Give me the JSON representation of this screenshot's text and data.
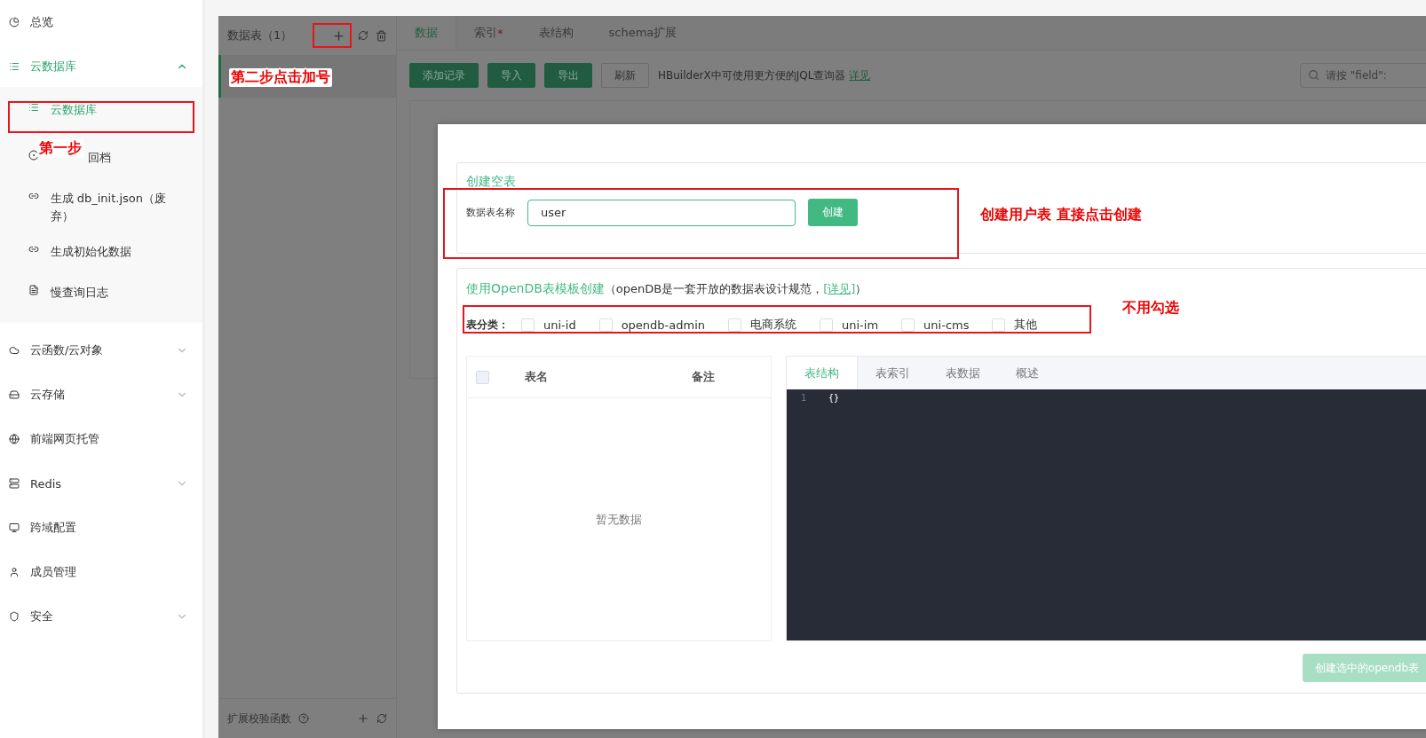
{
  "sidebar": {
    "items": [
      {
        "label": "总览",
        "selected": false
      },
      {
        "label": "云数据库",
        "selected": true,
        "expanded": true,
        "children": [
          {
            "label": "云数据库",
            "selected": true
          },
          {
            "label": "回档",
            "selected": false
          },
          {
            "label": "生成 db_init.json（废弃）",
            "selected": false
          },
          {
            "label": "生成初始化数据",
            "selected": false
          },
          {
            "label": "慢查询日志",
            "selected": false
          }
        ]
      },
      {
        "label": "云函数/云对象",
        "selected": false,
        "expanded": false
      },
      {
        "label": "云存储",
        "selected": false,
        "expanded": false
      },
      {
        "label": "前端网页托管",
        "selected": false
      },
      {
        "label": "Redis",
        "selected": false,
        "expanded": false
      },
      {
        "label": "跨域配置",
        "selected": false
      },
      {
        "label": "成员管理",
        "selected": false
      },
      {
        "label": "安全",
        "selected": false,
        "expanded": false
      }
    ]
  },
  "tables_panel": {
    "title": "数据表（1）",
    "tables": [
      {
        "selected": true
      }
    ],
    "footer": "扩展校验函数"
  },
  "tabs": [
    {
      "label": "数据",
      "selected": true
    },
    {
      "label": "索引",
      "badge": "*",
      "selected": false
    },
    {
      "label": "表结构",
      "selected": false
    },
    {
      "label": "schema扩展",
      "selected": false
    }
  ],
  "toolbar": {
    "buttons": [
      {
        "label": "添加记录",
        "kind": "primary"
      },
      {
        "label": "导入",
        "kind": "primary"
      },
      {
        "label": "导出",
        "kind": "primary"
      },
      {
        "label": "刷新",
        "kind": "default"
      }
    ],
    "hint": "HBuilderX中可使用更方便的JQL查询器",
    "hint_link": "详见",
    "search": {
      "placeholder": "请按 \"field\":"
    }
  },
  "modal": {
    "create_empty": {
      "title": "创建空表",
      "field_label": "数据表名称",
      "value": "user",
      "button": "创建"
    },
    "opendb": {
      "title": "使用OpenDB表模板创建",
      "note_before": "（openDB是一套开放的数据表设计规范，",
      "link": "[详见]",
      "note_after": "）",
      "category_label": "表分类：",
      "categories": [
        {
          "label": "uni-id",
          "checked": false
        },
        {
          "label": "opendb-admin",
          "checked": false
        },
        {
          "label": "电商系统",
          "checked": false
        },
        {
          "label": "uni-im",
          "checked": false
        },
        {
          "label": "uni-cms",
          "checked": false
        },
        {
          "label": "其他",
          "checked": false
        }
      ],
      "table": {
        "header_checked": false,
        "columns": [
          "表名",
          "备注"
        ],
        "empty": "暂无数据"
      },
      "editor_tabs": [
        {
          "label": "表结构",
          "selected": true
        },
        {
          "label": "表索引",
          "selected": false
        },
        {
          "label": "表数据",
          "selected": false
        },
        {
          "label": "概述",
          "selected": false
        }
      ],
      "lines": [
        {
          "number": "1",
          "text": "{}"
        }
      ],
      "submit": {
        "label": "创建选中的opendb表",
        "disabled": true
      }
    }
  },
  "annotations": [
    {
      "text": "第一步"
    },
    {
      "text": "第二步点击加号"
    },
    {
      "text": "创建用户表 直接点击创建"
    },
    {
      "text": "不用勾选"
    }
  ]
}
